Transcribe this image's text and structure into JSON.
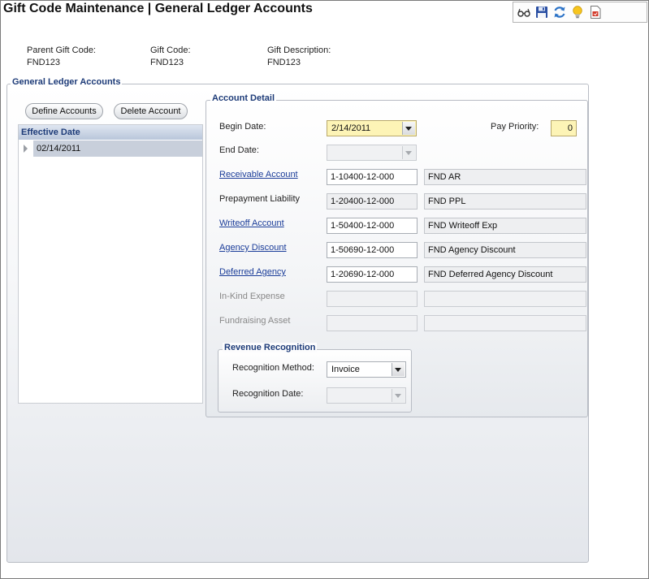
{
  "page_title": "Gift Code Maintenance  |  General Ledger Accounts",
  "toolbar": {
    "icons": [
      "glasses-icon",
      "save-icon",
      "refresh-icon",
      "lightbulb-icon",
      "report-icon"
    ]
  },
  "header": {
    "parent_gift_code_label": "Parent Gift Code:",
    "parent_gift_code_value": "FND123",
    "gift_code_label": "Gift Code:",
    "gift_code_value": "FND123",
    "gift_description_label": "Gift Description:",
    "gift_description_value": "FND123"
  },
  "gl_panel": {
    "legend": "General Ledger Accounts",
    "define_accounts_label": "Define Accounts",
    "delete_account_label": "Delete Account",
    "effective_date_header": "Effective Date",
    "effective_dates": [
      "02/14/2011"
    ]
  },
  "account_detail": {
    "legend": "Account Detail",
    "begin_date_label": "Begin Date:",
    "begin_date_value": "2/14/2011",
    "end_date_label": "End Date:",
    "end_date_value": "",
    "pay_priority_label": "Pay Priority:",
    "pay_priority_value": "0",
    "accounts": [
      {
        "label": "Receivable Account",
        "code": "1-10400-12-000",
        "description": "FND AR"
      },
      {
        "label": "Prepayment Liability",
        "code": "1-20400-12-000",
        "description": "FND PPL"
      },
      {
        "label": "Writeoff Account",
        "code": "1-50400-12-000",
        "description": "FND Writeoff Exp"
      },
      {
        "label": "Agency Discount",
        "code": "1-50690-12-000",
        "description": "FND Agency Discount"
      },
      {
        "label": "Deferred Agency",
        "code": "1-20690-12-000",
        "description": "FND Deferred Agency Discount"
      },
      {
        "label": "In-Kind Expense",
        "code": "",
        "description": ""
      },
      {
        "label": "Fundraising Asset",
        "code": "",
        "description": ""
      }
    ]
  },
  "revenue_recognition": {
    "legend": "Revenue Recognition",
    "method_label": "Recognition Method:",
    "method_value": "Invoice",
    "date_label": "Recognition Date:",
    "date_value": ""
  }
}
